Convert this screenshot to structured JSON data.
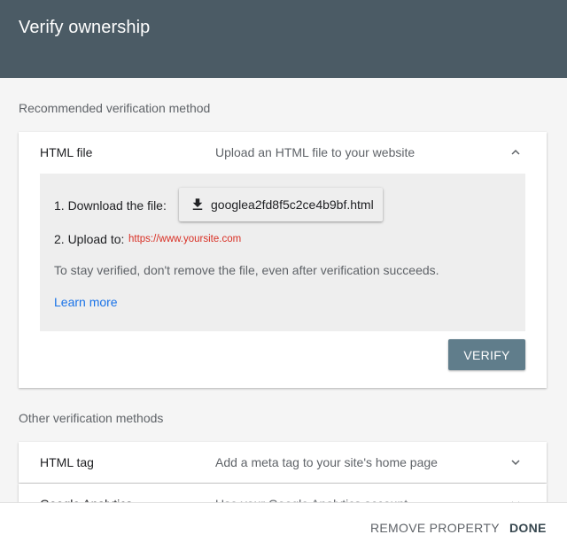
{
  "header": {
    "title": "Verify ownership"
  },
  "recommended": {
    "section_label": "Recommended verification method",
    "method": {
      "title": "HTML file",
      "description": "Upload an HTML file to your website",
      "chevron_icon": "chevron-up-icon",
      "step1_label": "1. Download the file:",
      "download_icon": "download-icon",
      "file_name": "googlea2fd8f5c2ce4b9bf.html",
      "step2_label": "2. Upload to:",
      "site_url": "https://www.yoursite.com",
      "note": "To stay verified, don't remove the file, even after verification succeeds.",
      "learn_more": "Learn more",
      "verify_label": "VERIFY"
    }
  },
  "other": {
    "section_label": "Other verification methods",
    "methods": [
      {
        "title": "HTML tag",
        "description": "Add a meta tag to your site's home page",
        "chevron_icon": "chevron-down-icon"
      },
      {
        "title": "Google Analytics",
        "description": "Use your Google Analytics account",
        "chevron_icon": "chevron-down-icon"
      }
    ]
  },
  "footer": {
    "remove_label": "REMOVE PROPERTY",
    "done_label": "DONE"
  },
  "colors": {
    "header_bg": "#4b5b65",
    "verify_bg": "#607d8b",
    "link": "#1a73e8",
    "url_red": "#d93025"
  }
}
